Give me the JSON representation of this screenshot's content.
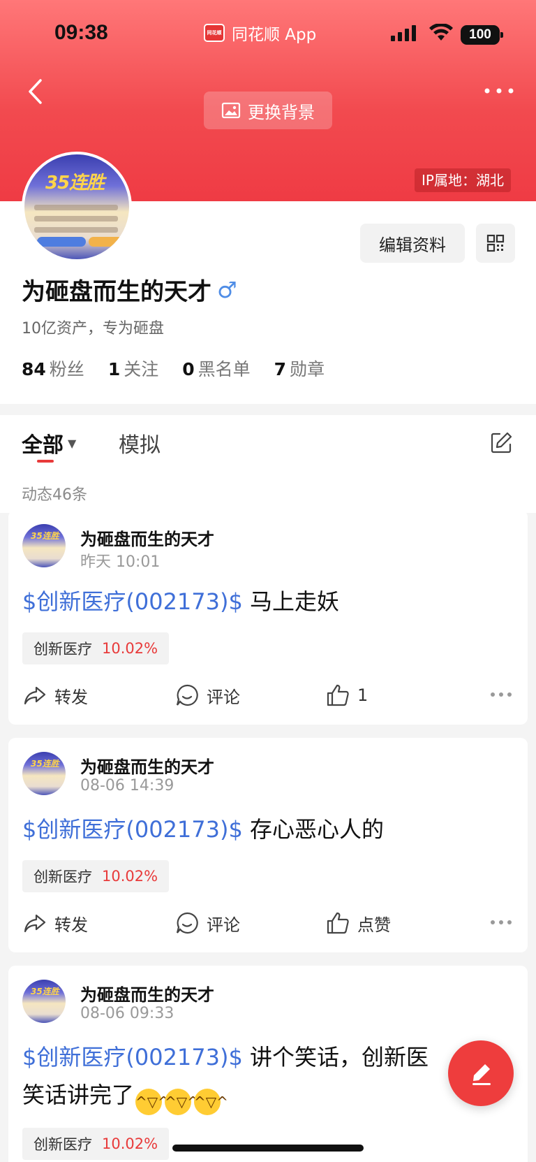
{
  "status_bar": {
    "time": "09:38",
    "app_name": "同花顺 App",
    "app_logo_text": "同花顺",
    "battery": "100"
  },
  "header": {
    "change_bg_label": "更换背景",
    "ip_location": "IP属地：湖北"
  },
  "profile": {
    "avatar_text": "35连胜",
    "nickname": "为砸盘而生的天才",
    "gender_symbol": "♂",
    "bio": "10亿资产，专为砸盘",
    "edit_label": "编辑资料",
    "stats": [
      {
        "num": "84",
        "label": "粉丝"
      },
      {
        "num": "1",
        "label": "关注"
      },
      {
        "num": "0",
        "label": "黑名单"
      },
      {
        "num": "7",
        "label": "勋章"
      }
    ]
  },
  "tabs": {
    "all": "全部",
    "sim": "模拟",
    "count": "动态46条"
  },
  "posts": [
    {
      "name": "为砸盘而生的天才",
      "time": "昨天 10:01",
      "stock": "$创新医疗(002173)$",
      "text": " 马上走妖",
      "chip_name": "创新医疗",
      "chip_pct": "10.02%",
      "repost": "转发",
      "comment": "评论",
      "like": "1"
    },
    {
      "name": "为砸盘而生的天才",
      "time": "08-06 14:39",
      "stock": "$创新医疗(002173)$",
      "text": " 存心恶心人的",
      "chip_name": "创新医疗",
      "chip_pct": "10.02%",
      "repost": "转发",
      "comment": "评论",
      "like": "点赞"
    },
    {
      "name": "为砸盘而生的天才",
      "time": "08-06 09:33",
      "stock": "$创新医疗(002173)$",
      "text": " 讲个笑话，创新医",
      "text_line2": "笑话讲完了",
      "chip_name": "创新医疗",
      "chip_pct": "10.02%"
    }
  ],
  "colors": {
    "brand_red": "#ef3b44",
    "link_blue": "#3f6fd8",
    "gain_red": "#e83a3a"
  }
}
